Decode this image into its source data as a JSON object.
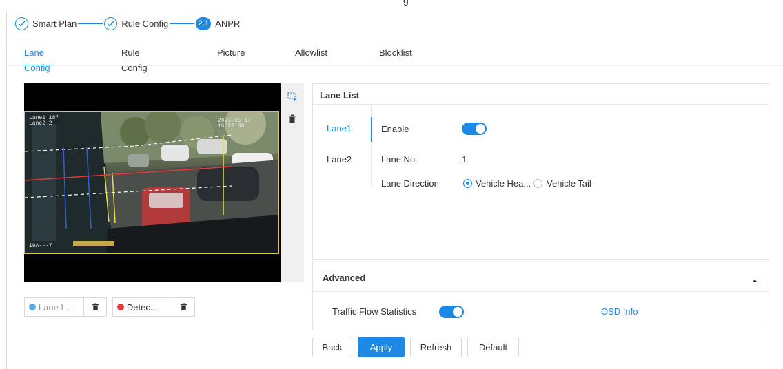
{
  "stepper": {
    "step1": "Smart Plan",
    "step2": "Rule Config",
    "step3_num": "2.1",
    "step3": "ANPR"
  },
  "tabs": [
    "Lane Config",
    "Rule Config",
    "Picture",
    "Allowlist",
    "Blocklist"
  ],
  "active_tab": "Lane Config",
  "video": {
    "osd_tl_1": "Lane1  187",
    "osd_tl_2": "Lane2  2",
    "osd_time": "2023-05-17 15:23:38",
    "osd_bl": "19A---7"
  },
  "chips": {
    "lane_line": "Lane L...",
    "detect": "Detec...",
    "lane_color": "#5aa9e6",
    "detect_color": "#e53935"
  },
  "lane_list": {
    "title": "Lane List",
    "lanes": [
      "Lane1",
      "Lane2"
    ],
    "enable_label": "Enable",
    "enable_on": true,
    "lane_no_label": "Lane No.",
    "lane_no_value": "1",
    "direction_label": "Lane Direction",
    "direction_options": [
      "Vehicle Hea...",
      "Vehicle Tail"
    ],
    "direction_selected": "Vehicle Hea..."
  },
  "advanced": {
    "title": "Advanced",
    "traffic_label": "Traffic Flow Statistics",
    "traffic_on": true,
    "osd_link": "OSD Info"
  },
  "buttons": {
    "back": "Back",
    "apply": "Apply",
    "refresh": "Refresh",
    "default": "Default"
  },
  "colors": {
    "accent": "#1e88e5"
  }
}
